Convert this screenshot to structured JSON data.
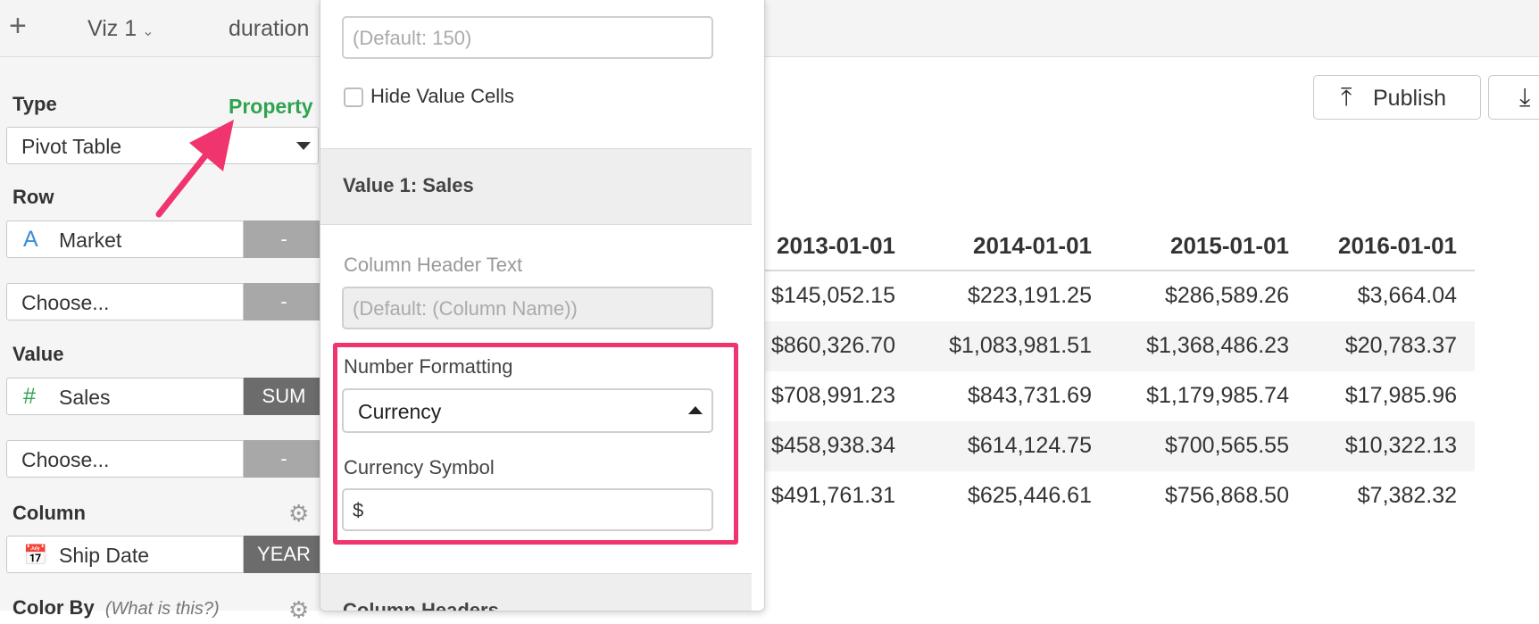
{
  "topbar": {
    "tabs": [
      {
        "label": "Viz 1"
      },
      {
        "label": "duration"
      }
    ]
  },
  "left_panel": {
    "type_label": "Type",
    "property_link": "Property",
    "type_value": "Pivot Table",
    "row_label": "Row",
    "row_field": "Market",
    "row_field_icon": "text-type-icon",
    "row_agg": "-",
    "row_choose": "Choose...",
    "row_choose_agg": "-",
    "value_label": "Value",
    "value_field": "Sales",
    "value_field_icon": "number-type-icon",
    "value_agg": "SUM",
    "value_choose": "Choose...",
    "value_choose_agg": "-",
    "column_label": "Column",
    "column_field": "Ship Date",
    "column_field_icon": "calendar-icon",
    "column_agg": "YEAR",
    "color_by_label": "Color By",
    "color_by_help": "(What is this?)"
  },
  "popup": {
    "width_placeholder": "(Default: 150)",
    "hide_value_cells_label": "Hide Value Cells",
    "section_value": "Value 1: Sales",
    "column_header_text_label": "Column Header Text",
    "column_header_text_placeholder": "(Default: (Column Name))",
    "number_formatting_label": "Number Formatting",
    "number_formatting_value": "Currency",
    "currency_symbol_label": "Currency Symbol",
    "currency_symbol_value": "$",
    "section_column_headers": "Column Headers",
    "highlight_color": "#f0346e"
  },
  "toolbar": {
    "publish_label": "Publish",
    "publish_icon": "upload-icon",
    "download_icon": "download-icon"
  },
  "table": {
    "headers": [
      "2013-01-01",
      "2014-01-01",
      "2015-01-01",
      "2016-01-01"
    ],
    "rows": [
      [
        "$145,052.15",
        "$223,191.25",
        "$286,589.26",
        "$3,664.04"
      ],
      [
        "$860,326.70",
        "$1,083,981.51",
        "$1,368,486.23",
        "$20,783.37"
      ],
      [
        "$708,991.23",
        "$843,731.69",
        "$1,179,985.74",
        "$17,985.96"
      ],
      [
        "$458,938.34",
        "$614,124.75",
        "$700,565.55",
        "$10,322.13"
      ],
      [
        "$491,761.31",
        "$625,446.61",
        "$756,868.50",
        "$7,382.32"
      ]
    ]
  },
  "colors": {
    "accent_green": "#2ea44f",
    "arrow_pink": "#f0346e"
  }
}
